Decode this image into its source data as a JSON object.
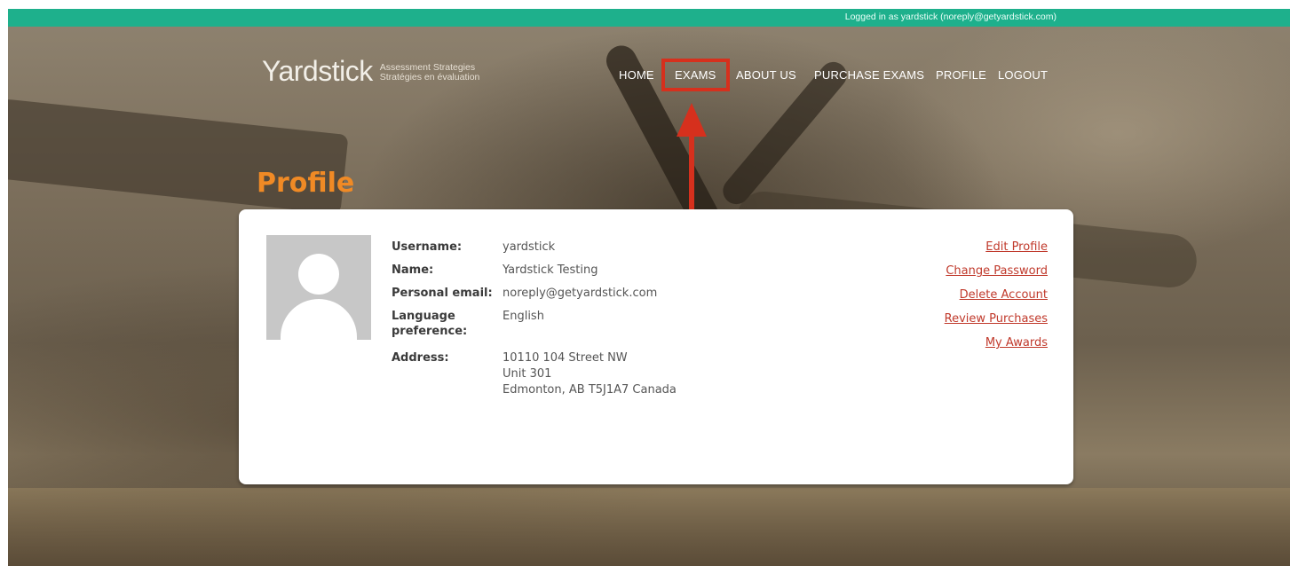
{
  "topbar": {
    "logged_in_text": "Logged in as yardstick (noreply@getyardstick.com)"
  },
  "logo": {
    "word": "Yardstic",
    "letter_k": "k",
    "tagline_en": "Assessment Strategies",
    "tagline_fr": "Stratégies en évaluation"
  },
  "nav": {
    "items": [
      {
        "label": "HOME"
      },
      {
        "label": "EXAMS",
        "highlighted": true
      },
      {
        "label": "ABOUT US"
      },
      {
        "label": "PURCHASE EXAMS"
      },
      {
        "label": "PROFILE"
      },
      {
        "label": "LOGOUT"
      }
    ]
  },
  "page": {
    "title": "Profile"
  },
  "profile": {
    "fields": [
      {
        "label": "Username:",
        "value": [
          "yardstick"
        ]
      },
      {
        "label": "Name:",
        "value": [
          "Yardstick Testing"
        ]
      },
      {
        "label": "Personal email:",
        "value": [
          "noreply@getyardstick.com"
        ]
      },
      {
        "label": "Language preference:",
        "value": [
          "English"
        ]
      },
      {
        "label": "Address:",
        "value": [
          "10110 104 Street NW",
          "Unit 301",
          "Edmonton, AB T5J1A7 Canada"
        ]
      }
    ]
  },
  "actions": {
    "links": [
      {
        "label": "Edit Profile"
      },
      {
        "label": "Change Password"
      },
      {
        "label": "Delete Account"
      },
      {
        "label": "Review Purchases"
      },
      {
        "label": "My Awards"
      }
    ]
  },
  "colors": {
    "topbar": "#1eb08c",
    "title": "#f08a25",
    "link": "#c0392b",
    "annotation": "#d6301d"
  }
}
